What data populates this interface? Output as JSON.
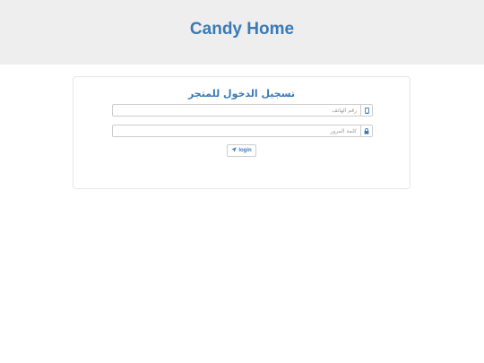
{
  "header": {
    "brand": "Candy Home"
  },
  "login_form": {
    "title": "تسجيل الدخول للمتجر",
    "phone": {
      "placeholder": "رقم الهاتف",
      "value": "",
      "icon": "mobile-phone-icon"
    },
    "password": {
      "placeholder": "كلمة المرور",
      "value": "",
      "icon": "lock-icon"
    },
    "submit": {
      "label": "login",
      "icon": "paper-plane-icon"
    }
  },
  "colors": {
    "accent": "#3a7ab5",
    "header_bg": "#eeeeee",
    "border": "#cccccc"
  }
}
